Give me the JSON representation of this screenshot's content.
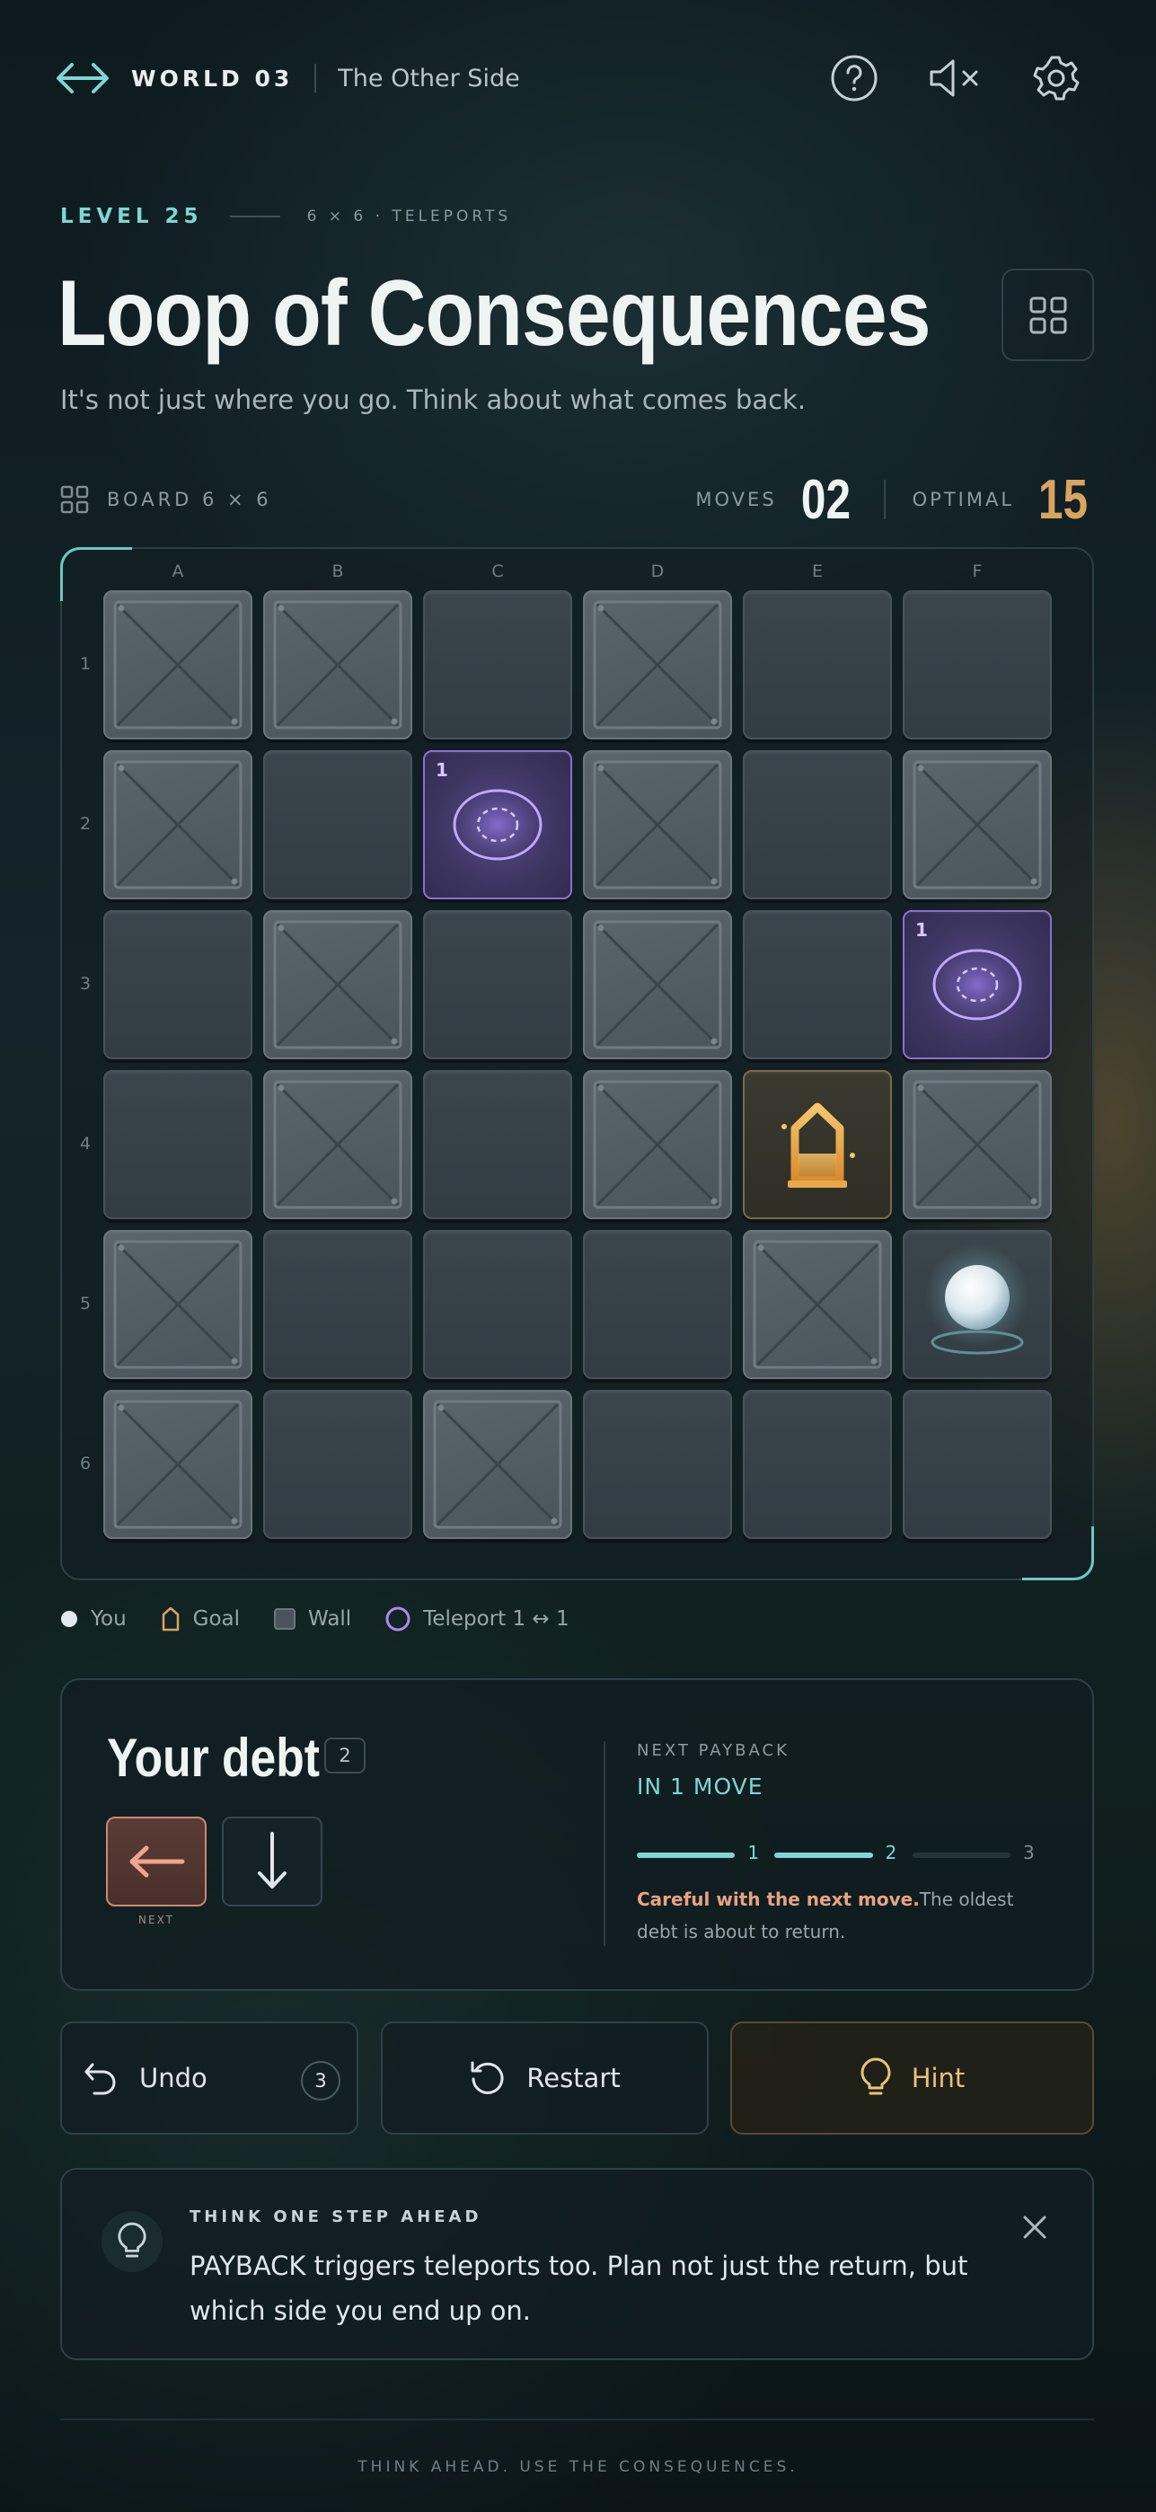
{
  "header": {
    "world_label": "WORLD 03",
    "world_name": "The Other Side",
    "icons": [
      "double-arrow-logo-icon",
      "help-icon",
      "mute-icon",
      "settings-icon"
    ]
  },
  "level": {
    "label": "LEVEL 25",
    "meta": "6 × 6 · TELEPORTS",
    "title": "Loop of Consequences",
    "subtitle": "It's not just where you go. Think about what comes back."
  },
  "stats": {
    "board_label": "BOARD 6 × 6",
    "moves_label": "MOVES",
    "moves_value": "02",
    "optimal_label": "OPTIMAL",
    "optimal_value": "15"
  },
  "board": {
    "columns": [
      "A",
      "B",
      "C",
      "D",
      "E",
      "F"
    ],
    "rows": [
      "1",
      "2",
      "3",
      "4",
      "5",
      "6"
    ],
    "cells": [
      [
        "wall",
        "wall",
        "empty",
        "wall",
        "empty",
        "empty"
      ],
      [
        "wall",
        "empty",
        "teleport",
        "wall",
        "empty",
        "wall"
      ],
      [
        "empty",
        "wall",
        "empty",
        "wall",
        "empty",
        "teleport"
      ],
      [
        "empty",
        "wall",
        "empty",
        "wall",
        "goal",
        "wall"
      ],
      [
        "wall",
        "empty",
        "empty",
        "empty",
        "wall",
        "player"
      ],
      [
        "wall",
        "empty",
        "wall",
        "empty",
        "empty",
        "empty"
      ]
    ],
    "teleport_number": "1"
  },
  "legend": {
    "you": "You",
    "goal": "Goal",
    "wall": "Wall",
    "teleport": "Teleport 1 ↔ 1"
  },
  "debt": {
    "title": "Your debt",
    "count": "2",
    "moves": [
      "left-arrow-icon",
      "down-arrow-icon"
    ],
    "next_label": "NEXT",
    "payback_label": "NEXT PAYBACK",
    "payback_value": "IN 1 MOVE",
    "steps": [
      "1",
      "2",
      "3"
    ],
    "steps_filled": 2,
    "warning_strong": "Careful with the next move.",
    "warning_rest": "The oldest debt is about to return."
  },
  "actions": {
    "undo_label": "Undo",
    "undo_count": "3",
    "restart_label": "Restart",
    "hint_label": "Hint"
  },
  "tip": {
    "heading": "THINK ONE STEP AHEAD",
    "body": "PAYBACK triggers teleports too. Plan not just the return, but which side you end up on."
  },
  "footer": "THINK AHEAD. USE THE CONSEQUENCES.",
  "colors": {
    "accent": "#7fd6d2",
    "gold": "#d9a45e",
    "teleport": "#8d6fd0",
    "warning": "#e8a382"
  }
}
